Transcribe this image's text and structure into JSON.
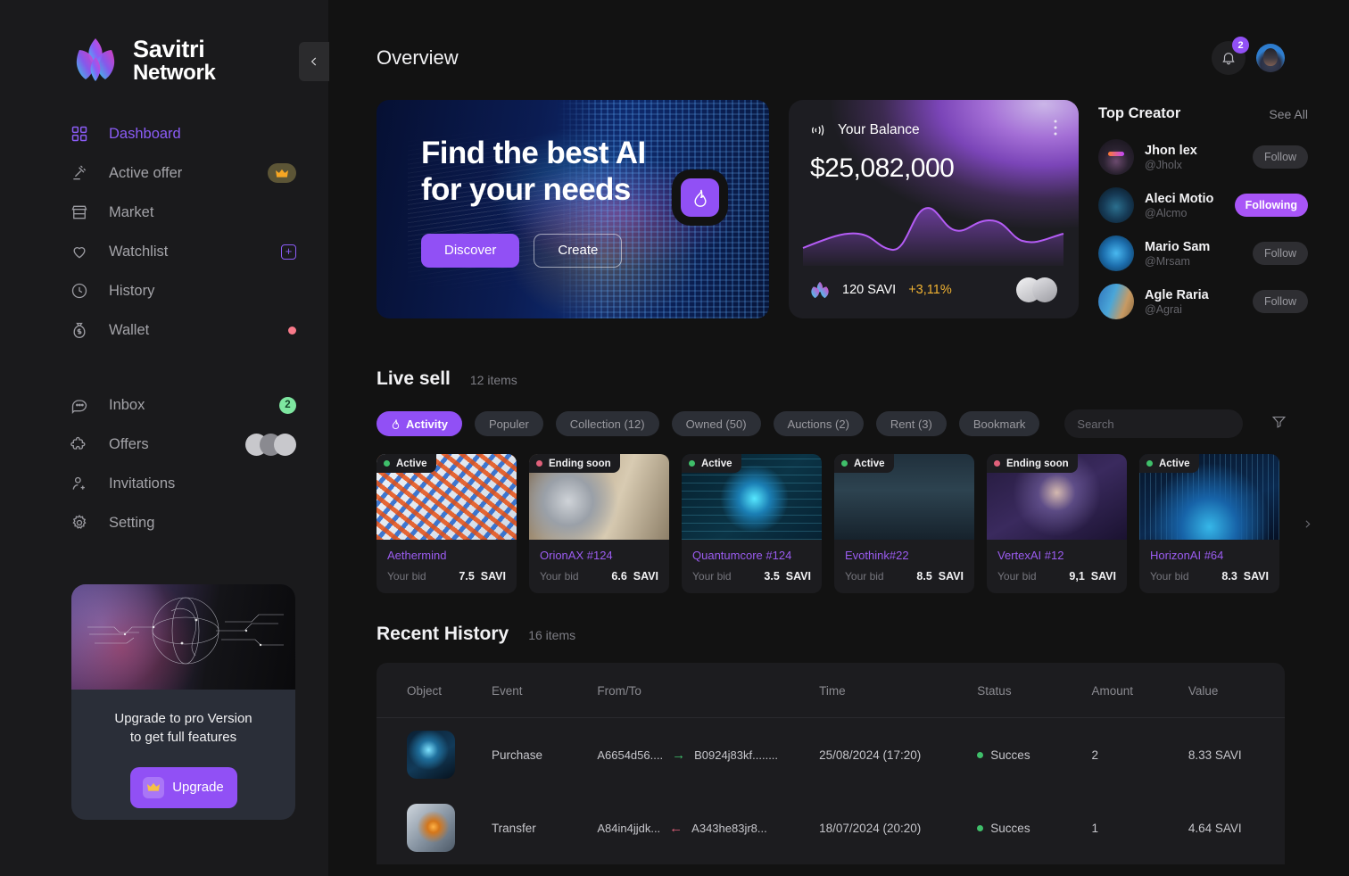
{
  "brand": {
    "name_line1": "Savitri",
    "name_line2": "Network",
    "accent": "#9150f5"
  },
  "sidebar": {
    "collapse_icon": "chevron-left-icon",
    "nav": [
      {
        "label": "Dashboard",
        "icon": "grid-icon",
        "active": true,
        "badge": null
      },
      {
        "label": "Active offer",
        "icon": "gavel-icon",
        "active": false,
        "badge": "crown"
      },
      {
        "label": "Market",
        "icon": "store-icon",
        "active": false,
        "badge": null
      },
      {
        "label": "Watchlist",
        "icon": "heart-icon",
        "active": false,
        "badge": "plus"
      },
      {
        "label": "History",
        "icon": "clock-icon",
        "active": false,
        "badge": null
      },
      {
        "label": "Wallet",
        "icon": "money-bag-icon",
        "active": false,
        "badge": "dot"
      }
    ],
    "nav2": [
      {
        "label": "Inbox",
        "icon": "chat-icon",
        "badge": "2"
      },
      {
        "label": "Offers",
        "icon": "puzzle-icon",
        "badge": "avatars"
      },
      {
        "label": "Invitations",
        "icon": "user-plus-icon",
        "badge": null
      },
      {
        "label": "Setting",
        "icon": "gear-icon",
        "badge": null
      }
    ],
    "upgrade": {
      "text_line1": "Upgrade to pro Version",
      "text_line2": "to get full features",
      "button_label": "Upgrade",
      "button_icon": "crown-icon"
    }
  },
  "header": {
    "title": "Overview",
    "notification_count": "2",
    "bell_icon": "bell-icon",
    "avatar": "user-avatar"
  },
  "hero": {
    "title_line1": "Find the best AI",
    "title_line2": "for your needs",
    "primary_button": "Discover",
    "secondary_button": "Create",
    "fab_icon": "flame-icon"
  },
  "balance": {
    "label": "Your Balance",
    "icon": "broadcast-icon",
    "menu_icon": "more-vertical-icon",
    "amount": "$25,082,000",
    "token": "120 SAVI",
    "change": "+3,11%",
    "change_color": "#f0b232",
    "token_icon": "savitri-token-icon"
  },
  "creators": {
    "title": "Top Creator",
    "see_all": "See All",
    "list": [
      {
        "name": "Jhon lex",
        "handle": "@Jholx",
        "action": "Follow",
        "following": false
      },
      {
        "name": "Aleci Motio",
        "handle": "@Alcmo",
        "action": "Following",
        "following": true
      },
      {
        "name": "Mario Sam",
        "handle": "@Mrsam",
        "action": "Follow",
        "following": false
      },
      {
        "name": "Agle Raria",
        "handle": "@Agrai",
        "action": "Follow",
        "following": false
      }
    ]
  },
  "live_sell": {
    "title": "Live sell",
    "count": "12 items",
    "chips": [
      {
        "label": "Activity",
        "active": true,
        "icon": "flame-icon"
      },
      {
        "label": "Populer",
        "active": false
      },
      {
        "label": "Collection (12)",
        "active": false
      },
      {
        "label": "Owned (50)",
        "active": false
      },
      {
        "label": "Auctions (2)",
        "active": false
      },
      {
        "label": "Rent   (3)",
        "active": false
      },
      {
        "label": "Bookmark",
        "active": false
      }
    ],
    "search_placeholder": "Search",
    "search_value": "",
    "search_icon": "search-icon",
    "filter_icon": "funnel-icon",
    "next_icon": "chevron-right-icon",
    "bid_label": "Your bid",
    "cards": [
      {
        "status": "Active",
        "status_color": "#3fbf6a",
        "name": "Aethermind",
        "bid": "7.5",
        "unit": "SAVI",
        "art": "art1"
      },
      {
        "status": "Ending soon",
        "status_color": "#e0607a",
        "name": "OrionAX #124",
        "bid": "6.6",
        "unit": "SAVI",
        "art": "art2"
      },
      {
        "status": "Active",
        "status_color": "#3fbf6a",
        "name": "Quantumcore #124",
        "bid": "3.5",
        "unit": "SAVI",
        "art": "art3"
      },
      {
        "status": "Active",
        "status_color": "#3fbf6a",
        "name": "Evothink#22",
        "bid": "8.5",
        "unit": "SAVI",
        "art": "art4"
      },
      {
        "status": "Ending soon",
        "status_color": "#e0607a",
        "name": "VertexAI #12",
        "bid": "9,1",
        "unit": "SAVI",
        "art": "art5"
      },
      {
        "status": "Active",
        "status_color": "#3fbf6a",
        "name": "HorizonAI #64",
        "bid": "8.3",
        "unit": "SAVI",
        "art": "art6"
      }
    ]
  },
  "history": {
    "title": "Recent History",
    "count": "16 items",
    "columns": [
      "Object",
      "Event",
      "From/To",
      "Time",
      "Status",
      "Amount",
      "Value"
    ],
    "rows": [
      {
        "event": "Purchase",
        "from": "A6654d56....",
        "direction": "right",
        "to": "B0924j83kf........",
        "time": "25/08/2024 (17:20)",
        "status": "Succes",
        "amount": "2",
        "value": "8.33 SAVI",
        "thumb": "th1"
      },
      {
        "event": "Transfer",
        "from": "A84in4jjdk...",
        "direction": "left",
        "to": "A343he83jr8...",
        "time": "18/07/2024 (20:20)",
        "status": "Succes",
        "amount": "1",
        "value": "4.64 SAVI",
        "thumb": "th2"
      }
    ]
  }
}
